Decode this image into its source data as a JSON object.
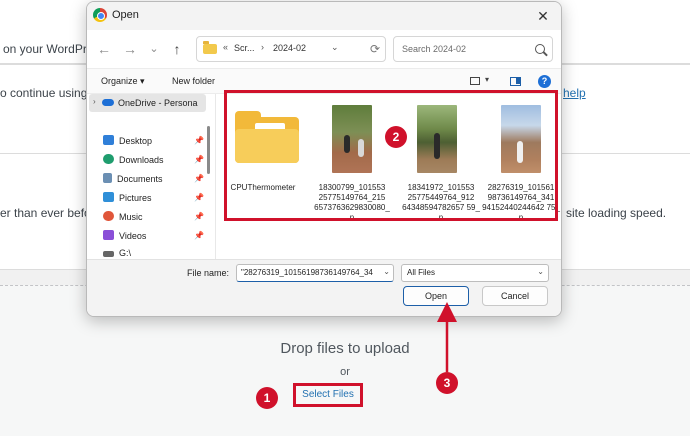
{
  "background": {
    "text_top": "on your WordPress",
    "text_continue": "o continue using Si",
    "help_link": "help",
    "text_ever": "er than ever before.",
    "text_site": "site loading speed.",
    "drop_text": "Drop files to upload",
    "or_text": "or",
    "select_files": "Select Files"
  },
  "dialog": {
    "title": "Open",
    "close": "✕",
    "nav": {
      "back": "←",
      "forward": "→",
      "dropdown": "⌄",
      "up": "↑"
    },
    "breadcrumbs": [
      "«",
      "Scr...",
      "›",
      "2024-02",
      "⌄"
    ],
    "refresh": "⟳",
    "search_placeholder": "Search 2024-02",
    "commands": {
      "organize": "Organize ▾",
      "new_folder": "New folder",
      "help": "?"
    },
    "nav_pane": {
      "selected": "OneDrive - Persona",
      "items": [
        {
          "label": "Desktop",
          "color": "#2f7fd8"
        },
        {
          "label": "Downloads",
          "color": "#1f9d6e"
        },
        {
          "label": "Documents",
          "color": "#6b8fb3"
        },
        {
          "label": "Pictures",
          "color": "#2f8fd8"
        },
        {
          "label": "Music",
          "color": "#e0563a"
        },
        {
          "label": "Videos",
          "color": "#8a4fd8"
        },
        {
          "label": "G:\\",
          "color": "#666666"
        }
      ],
      "pin": "📌"
    },
    "files": [
      {
        "name": "CPUThermometer",
        "kind": "folder"
      },
      {
        "name": "18300799_10155325775149764_2156573763629830080_n",
        "label": "18300799_101553\n25775149764_215\n6573763629830080_n",
        "kind": "image"
      },
      {
        "name": "18341972_10155325775449764_9126434859478265759_n",
        "label": "18341972_101553\n25775449764_912\n64348594782657 59_n",
        "kind": "image"
      },
      {
        "name": "28276319_10156198736149764_3419415244024464275_n",
        "label": "28276319_101561\n98736149764_341\n94152440244642 75_n",
        "kind": "image"
      }
    ],
    "file_name_label": "File name:",
    "file_name_value": "\"28276319_10156198736149764_34",
    "file_type": "All Files",
    "open_button": "Open",
    "cancel_button": "Cancel"
  },
  "annotations": {
    "badge1": "1",
    "badge2": "2",
    "badge3": "3",
    "color": "#d0112b"
  }
}
